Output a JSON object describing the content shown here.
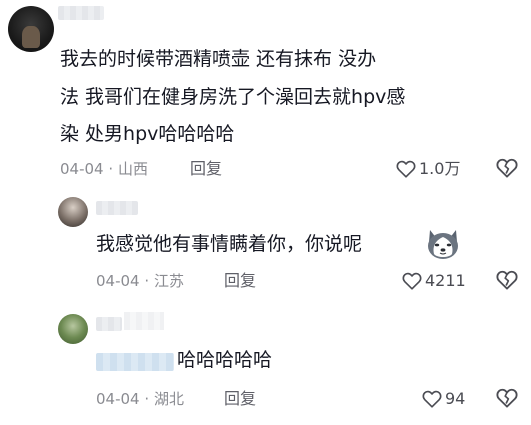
{
  "comment": {
    "text_lines": [
      "我去的时候带酒精喷壶    还有抹布    没办",
      "法   我哥们在健身房洗了个澡回去就hpv感",
      "染     处男hpv哈哈哈哈"
    ],
    "date": "04-04",
    "location": "山西",
    "reply_label": "回复",
    "likes": "1.0万"
  },
  "replies": [
    {
      "text": "我感觉他有事情瞒着你，你说呢",
      "emoji_icon": "husky-emoji-icon",
      "date": "04-04",
      "location": "江苏",
      "reply_label": "回复",
      "likes": "4211"
    },
    {
      "text": "哈哈哈哈哈",
      "date": "04-04",
      "location": "湖北",
      "reply_label": "回复",
      "likes": "94"
    }
  ],
  "meta_separator": "·",
  "icons": {
    "like": "heart-outline-icon",
    "dislike": "broken-heart-icon"
  },
  "colors": {
    "text": "#161823",
    "meta": "#8a8b91",
    "background": "#ffffff"
  }
}
